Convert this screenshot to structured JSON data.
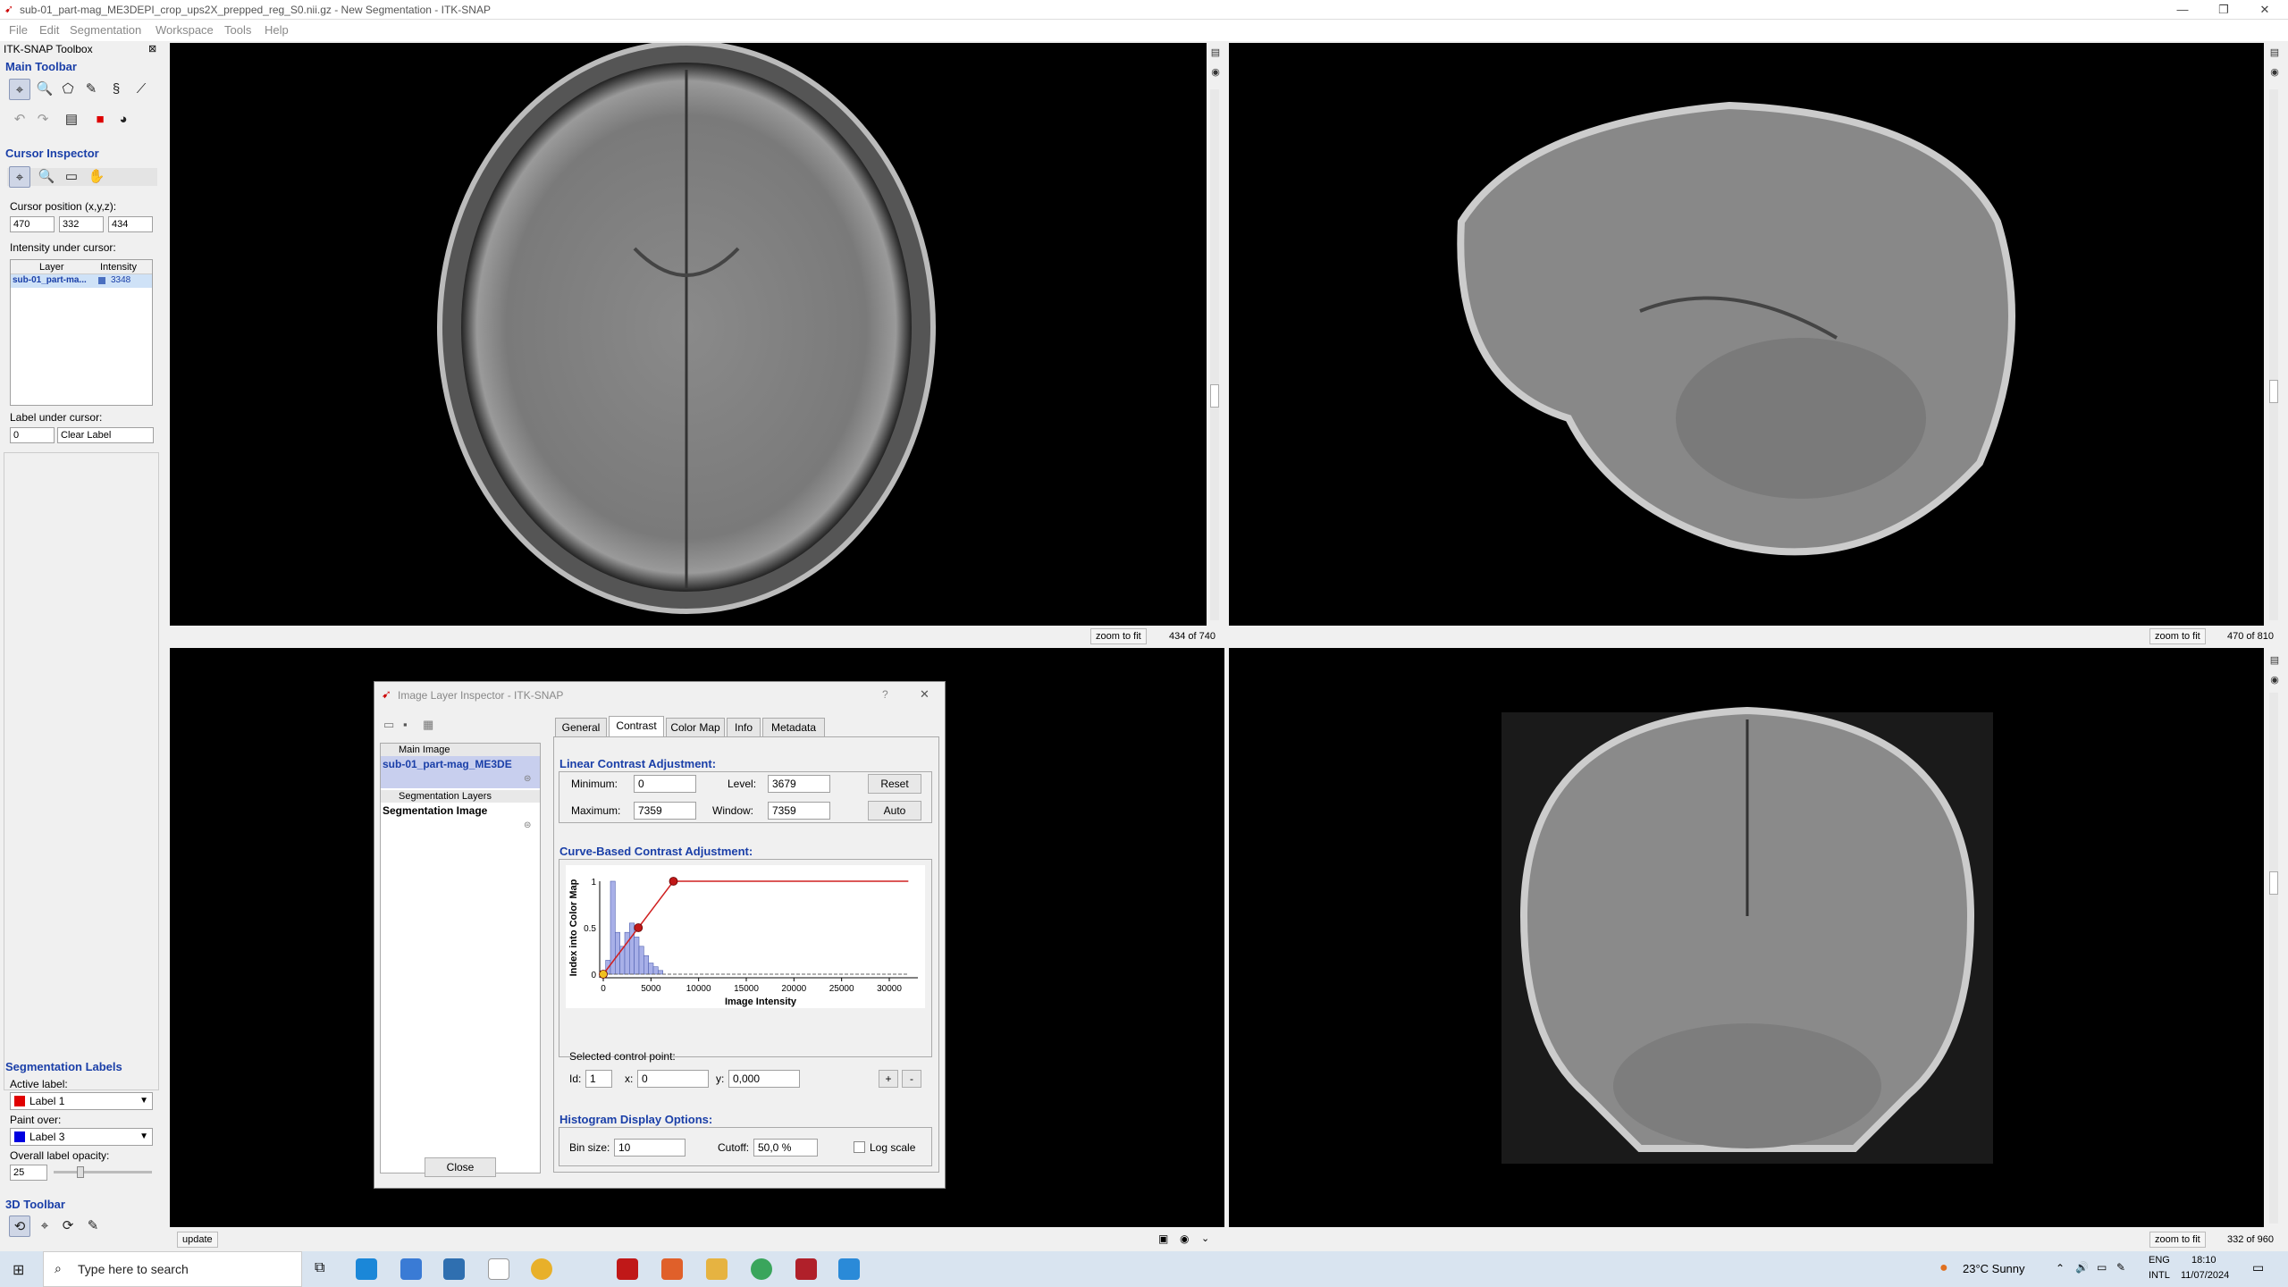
{
  "window": {
    "title": "sub-01_part-mag_ME3DEPI_crop_ups2X_prepped_reg_S0.nii.gz - New Segmentation - ITK-SNAP",
    "menu": [
      "File",
      "Edit",
      "Segmentation",
      "Workspace",
      "Tools",
      "Help"
    ]
  },
  "toolbox": {
    "title": "ITK-SNAP Toolbox",
    "main_toolbar": "Main Toolbar",
    "cursor_inspector": {
      "title": "Cursor Inspector",
      "position_label": "Cursor position (x,y,z):",
      "x": "470",
      "y": "332",
      "z": "434",
      "intensity_label": "Intensity under cursor:",
      "col_layer": "Layer",
      "col_intensity": "Intensity",
      "row_layer": "sub-01_part-ma...",
      "row_intensity": "3348",
      "label_under_cursor": "Label under cursor:",
      "label_id": "0",
      "label_name": "Clear Label"
    },
    "seg_labels": {
      "title": "Segmentation Labels",
      "active_label": "Active label:",
      "active_value": "Label 1",
      "active_color": "#e00000",
      "paint_over": "Paint over:",
      "paint_value": "Label 3",
      "paint_color": "#0000e0",
      "opacity_label": "Overall label opacity:",
      "opacity_value": "25",
      "opacity_fraction": 0.25
    },
    "toolbar_3d": "3D Toolbar"
  },
  "views": {
    "zoom_label": "zoom to fit",
    "axial_slice": "434 of 740",
    "sagittal_slice": "470 of 810",
    "coronal_slice": "332 of 960",
    "update_label": "update"
  },
  "dialog": {
    "title": "Image Layer Inspector - ITK-SNAP",
    "help": "?",
    "close_x": "✕",
    "main_image_header": "Main Image",
    "main_image_name": "sub-01_part-mag_ME3DE",
    "seg_layers_header": "Segmentation Layers",
    "seg_image_name": "Segmentation Image",
    "close_button": "Close",
    "tabs": [
      "General",
      "Contrast",
      "Color Map",
      "Info",
      "Metadata"
    ],
    "linear": {
      "title": "Linear Contrast Adjustment:",
      "min_label": "Minimum:",
      "min_value": "0",
      "max_label": "Maximum:",
      "max_value": "7359",
      "level_label": "Level:",
      "level_value": "3679",
      "window_label": "Window:",
      "window_value": "7359",
      "reset": "Reset",
      "auto": "Auto"
    },
    "curve": {
      "title": "Curve-Based Contrast Adjustment:",
      "selected_label": "Selected control point:",
      "id_label": "Id:",
      "id_value": "1",
      "x_label": "x:",
      "x_value": "0",
      "y_label": "y:",
      "y_value": "0,000",
      "plus": "+",
      "minus": "-"
    },
    "histogram": {
      "title": "Histogram Display Options:",
      "bin_label": "Bin size:",
      "bin_value": "10",
      "cutoff_label": "Cutoff:",
      "cutoff_value": "50,0 %",
      "log_label": "Log scale"
    }
  },
  "chart_data": {
    "type": "line",
    "xlabel": "Image Intensity",
    "ylabel": "Index into Color Map",
    "xlim": [
      0,
      33000
    ],
    "ylim": [
      0,
      1
    ],
    "x_ticks": [
      "0",
      "5000",
      "10000",
      "15000",
      "20000",
      "25000",
      "30000"
    ],
    "y_ticks": [
      "0",
      "0.5",
      "1"
    ],
    "curve_points": [
      [
        0,
        0
      ],
      [
        3679,
        0.5
      ],
      [
        7359,
        1
      ],
      [
        32000,
        1
      ]
    ],
    "histogram": [
      {
        "x": 500,
        "y": 0.15
      },
      {
        "x": 1000,
        "y": 1.0
      },
      {
        "x": 1500,
        "y": 0.45
      },
      {
        "x": 2000,
        "y": 0.3
      },
      {
        "x": 2500,
        "y": 0.45
      },
      {
        "x": 3000,
        "y": 0.55
      },
      {
        "x": 3500,
        "y": 0.4
      },
      {
        "x": 4000,
        "y": 0.3
      },
      {
        "x": 4500,
        "y": 0.2
      },
      {
        "x": 5000,
        "y": 0.12
      },
      {
        "x": 5500,
        "y": 0.08
      },
      {
        "x": 6000,
        "y": 0.04
      }
    ]
  },
  "taskbar": {
    "search_placeholder": "Type here to search",
    "weather": "23°C  Sunny",
    "lang1": "ENG",
    "lang2": "INTL",
    "time": "18:10",
    "date": "11/07/2024"
  }
}
